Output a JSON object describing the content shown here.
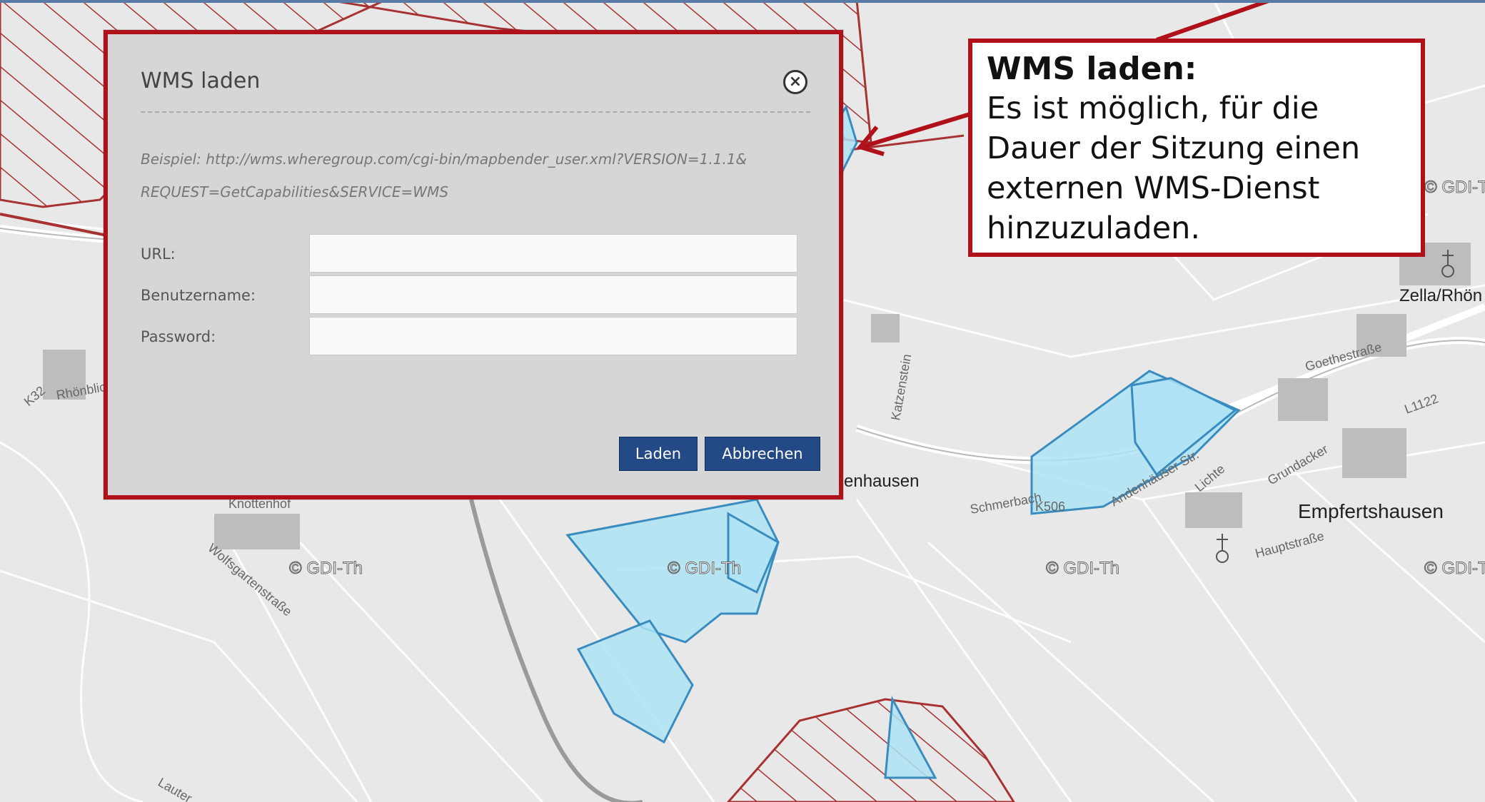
{
  "dialog": {
    "title": "WMS laden",
    "example_line1": "Beispiel: http://wms.wheregroup.com/cgi-bin/mapbender_user.xml?VERSION=1.1.1&",
    "example_line2": "REQUEST=GetCapabilities&SERVICE=WMS",
    "fields": [
      {
        "label": "URL:",
        "value": ""
      },
      {
        "label": "Benutzername:",
        "value": ""
      },
      {
        "label": "Password:",
        "value": ""
      }
    ],
    "load_label": "Laden",
    "cancel_label": "Abbrechen",
    "close_icon": "close-circle-icon"
  },
  "callout": {
    "title": "WMS laden:",
    "text": "Es ist möglich, für die Dauer der Sitzung einen externen WMS-Dienst hinzuzuladen."
  },
  "map": {
    "copyright": "© GDI-Th",
    "places": [
      "Zella/Rhön",
      "Empfertshausen",
      "enhausen",
      "Knottenhof"
    ],
    "streets": [
      "Goethestraße",
      "Hauptstraße",
      "Wolfsgartenstraße",
      "Andenhäuser Str.",
      "Grundacker",
      "Lichte",
      "Katzenstein",
      "Schmerbach",
      "Rhönblick",
      "Lauter"
    ],
    "roads": [
      "K32",
      "L1122",
      "K506"
    ],
    "colors": {
      "hatch": "#a83232",
      "area_fill": "#aee3f5",
      "area_stroke": "#3a8cbf",
      "accent": "#b0101a",
      "button": "#234a86"
    }
  }
}
